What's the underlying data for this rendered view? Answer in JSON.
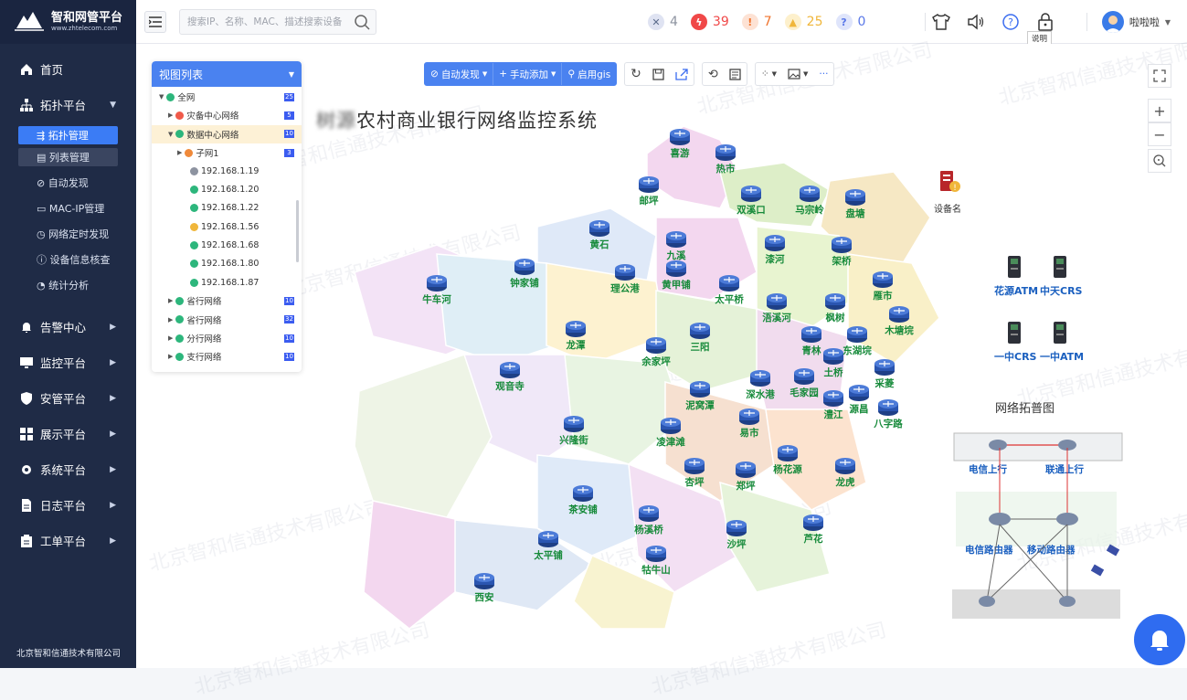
{
  "brand": {
    "title": "智和网管平台",
    "sub": "www.zhtelecom.com",
    "mark": "Sugar NMS"
  },
  "nav": {
    "home": "首页",
    "topology": "拓扑平台",
    "topo_subs": [
      "拓扑管理",
      "列表管理",
      "自动发现",
      "MAC-IP管理",
      "网络定时发现",
      "设备信息核查",
      "统计分析"
    ],
    "alarm": "告警中心",
    "monitor": "监控平台",
    "security": "安管平台",
    "display": "展示平台",
    "system": "系统平台",
    "log": "日志平台",
    "ticket": "工单平台"
  },
  "company": "北京智和信通技术有限公司",
  "search": {
    "placeholder": "搜索IP、名称、MAC、描述搜索设备"
  },
  "badges": [
    {
      "icon": "x-icon",
      "value": "4",
      "color": "#8d93a0"
    },
    {
      "icon": "lightning-icon",
      "value": "39",
      "color": "#f04848"
    },
    {
      "icon": "exclamation-icon",
      "value": "7",
      "color": "#f0742e"
    },
    {
      "icon": "bell-icon",
      "value": "25",
      "color": "#f0b63a"
    },
    {
      "icon": "question-icon",
      "value": "0",
      "color": "#5a78e8"
    }
  ],
  "tools": {
    "help_tooltip": "说明"
  },
  "user": {
    "name": "啦啦啦"
  },
  "tree": {
    "title": "视图列表",
    "rows": [
      {
        "label": "全网",
        "count": "25",
        "level": 0,
        "color": "#2db67c",
        "expanded": true
      },
      {
        "label": "灾备中心网络",
        "count": "5",
        "level": 1,
        "color": "#f05a4a",
        "expanded": false
      },
      {
        "label": "数据中心网络",
        "count": "10",
        "level": 1,
        "color": "#2db67c",
        "expanded": true,
        "highlight": true
      },
      {
        "label": "子网1",
        "count": "3",
        "level": 2,
        "color": "#f08a3a",
        "expanded": false
      },
      {
        "label": "192.168.1.19",
        "count": "",
        "level": 3,
        "color": "#8d93a0"
      },
      {
        "label": "192.168.1.20",
        "count": "",
        "level": 3,
        "color": "#2db67c"
      },
      {
        "label": "192.168.1.22",
        "count": "",
        "level": 3,
        "color": "#2db67c"
      },
      {
        "label": "192.168.1.56",
        "count": "",
        "level": 3,
        "color": "#f0b63a"
      },
      {
        "label": "192.168.1.68",
        "count": "",
        "level": 3,
        "color": "#2db67c"
      },
      {
        "label": "192.168.1.80",
        "count": "",
        "level": 3,
        "color": "#2db67c"
      },
      {
        "label": "192.168.1.87",
        "count": "",
        "level": 3,
        "color": "#2db67c"
      },
      {
        "label": "省行网络",
        "count": "10",
        "level": 1,
        "color": "#2db67c",
        "expanded": false
      },
      {
        "label": "省行网络",
        "count": "32",
        "level": 1,
        "color": "#2db67c",
        "expanded": false
      },
      {
        "label": "分行网络",
        "count": "10",
        "level": 1,
        "color": "#2db67c",
        "expanded": false
      },
      {
        "label": "支行网络",
        "count": "10",
        "level": 1,
        "color": "#2db67c",
        "expanded": false
      }
    ]
  },
  "toolbar": {
    "auto_discover": "自动发现",
    "manual_add": "手动添加",
    "enable_gis": "启用gis"
  },
  "map": {
    "title_blur": "树源",
    "title": "农村商业银行网络监控系统",
    "regions": [
      "喜游",
      "热市",
      "邮坪",
      "双溪口",
      "马宗岭",
      "盘塘",
      "黄石",
      "九溪",
      "漆河",
      "架桥",
      "钟家铺",
      "理公港",
      "黄甲铺",
      "太平桥",
      "雁市",
      "牛车河",
      "浯溪河",
      "枫树",
      "木塘垸",
      "龙潭",
      "三阳",
      "青林",
      "东湖垸",
      "余家坪",
      "观音寺",
      "泥窝潭",
      "深水港",
      "土桥",
      "采菱",
      "毛家园",
      "澧江",
      "源昌",
      "八字路",
      "易市",
      "兴隆街",
      "凌津滩",
      "杨花源",
      "茶安铺",
      "杏坪",
      "郑坪",
      "龙虎",
      "杨溪桥",
      "芦花",
      "太平铺",
      "沙坪",
      "西安",
      "牯牛山"
    ]
  },
  "devices": {
    "alert_device": "设备名",
    "items": [
      "花源ATM",
      "中天CRS",
      "一中CRS",
      "一中ATM"
    ]
  },
  "legend": {
    "title": "网络拓普图",
    "labels": [
      "电信上行",
      "联通上行",
      "电信路由器",
      "移动路由器"
    ]
  },
  "watermark": "北京智和信通技术有限公司"
}
